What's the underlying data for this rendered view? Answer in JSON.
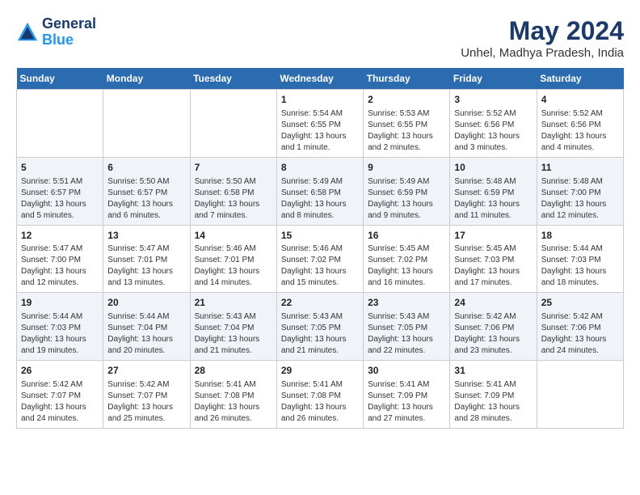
{
  "logo": {
    "line1": "General",
    "line2": "Blue"
  },
  "title": "May 2024",
  "subtitle": "Unhel, Madhya Pradesh, India",
  "headers": [
    "Sunday",
    "Monday",
    "Tuesday",
    "Wednesday",
    "Thursday",
    "Friday",
    "Saturday"
  ],
  "weeks": [
    [
      {
        "day": "",
        "content": ""
      },
      {
        "day": "",
        "content": ""
      },
      {
        "day": "",
        "content": ""
      },
      {
        "day": "1",
        "content": "Sunrise: 5:54 AM\nSunset: 6:55 PM\nDaylight: 13 hours\nand 1 minute."
      },
      {
        "day": "2",
        "content": "Sunrise: 5:53 AM\nSunset: 6:55 PM\nDaylight: 13 hours\nand 2 minutes."
      },
      {
        "day": "3",
        "content": "Sunrise: 5:52 AM\nSunset: 6:56 PM\nDaylight: 13 hours\nand 3 minutes."
      },
      {
        "day": "4",
        "content": "Sunrise: 5:52 AM\nSunset: 6:56 PM\nDaylight: 13 hours\nand 4 minutes."
      }
    ],
    [
      {
        "day": "5",
        "content": "Sunrise: 5:51 AM\nSunset: 6:57 PM\nDaylight: 13 hours\nand 5 minutes."
      },
      {
        "day": "6",
        "content": "Sunrise: 5:50 AM\nSunset: 6:57 PM\nDaylight: 13 hours\nand 6 minutes."
      },
      {
        "day": "7",
        "content": "Sunrise: 5:50 AM\nSunset: 6:58 PM\nDaylight: 13 hours\nand 7 minutes."
      },
      {
        "day": "8",
        "content": "Sunrise: 5:49 AM\nSunset: 6:58 PM\nDaylight: 13 hours\nand 8 minutes."
      },
      {
        "day": "9",
        "content": "Sunrise: 5:49 AM\nSunset: 6:59 PM\nDaylight: 13 hours\nand 9 minutes."
      },
      {
        "day": "10",
        "content": "Sunrise: 5:48 AM\nSunset: 6:59 PM\nDaylight: 13 hours\nand 11 minutes."
      },
      {
        "day": "11",
        "content": "Sunrise: 5:48 AM\nSunset: 7:00 PM\nDaylight: 13 hours\nand 12 minutes."
      }
    ],
    [
      {
        "day": "12",
        "content": "Sunrise: 5:47 AM\nSunset: 7:00 PM\nDaylight: 13 hours\nand 12 minutes."
      },
      {
        "day": "13",
        "content": "Sunrise: 5:47 AM\nSunset: 7:01 PM\nDaylight: 13 hours\nand 13 minutes."
      },
      {
        "day": "14",
        "content": "Sunrise: 5:46 AM\nSunset: 7:01 PM\nDaylight: 13 hours\nand 14 minutes."
      },
      {
        "day": "15",
        "content": "Sunrise: 5:46 AM\nSunset: 7:02 PM\nDaylight: 13 hours\nand 15 minutes."
      },
      {
        "day": "16",
        "content": "Sunrise: 5:45 AM\nSunset: 7:02 PM\nDaylight: 13 hours\nand 16 minutes."
      },
      {
        "day": "17",
        "content": "Sunrise: 5:45 AM\nSunset: 7:03 PM\nDaylight: 13 hours\nand 17 minutes."
      },
      {
        "day": "18",
        "content": "Sunrise: 5:44 AM\nSunset: 7:03 PM\nDaylight: 13 hours\nand 18 minutes."
      }
    ],
    [
      {
        "day": "19",
        "content": "Sunrise: 5:44 AM\nSunset: 7:03 PM\nDaylight: 13 hours\nand 19 minutes."
      },
      {
        "day": "20",
        "content": "Sunrise: 5:44 AM\nSunset: 7:04 PM\nDaylight: 13 hours\nand 20 minutes."
      },
      {
        "day": "21",
        "content": "Sunrise: 5:43 AM\nSunset: 7:04 PM\nDaylight: 13 hours\nand 21 minutes."
      },
      {
        "day": "22",
        "content": "Sunrise: 5:43 AM\nSunset: 7:05 PM\nDaylight: 13 hours\nand 21 minutes."
      },
      {
        "day": "23",
        "content": "Sunrise: 5:43 AM\nSunset: 7:05 PM\nDaylight: 13 hours\nand 22 minutes."
      },
      {
        "day": "24",
        "content": "Sunrise: 5:42 AM\nSunset: 7:06 PM\nDaylight: 13 hours\nand 23 minutes."
      },
      {
        "day": "25",
        "content": "Sunrise: 5:42 AM\nSunset: 7:06 PM\nDaylight: 13 hours\nand 24 minutes."
      }
    ],
    [
      {
        "day": "26",
        "content": "Sunrise: 5:42 AM\nSunset: 7:07 PM\nDaylight: 13 hours\nand 24 minutes."
      },
      {
        "day": "27",
        "content": "Sunrise: 5:42 AM\nSunset: 7:07 PM\nDaylight: 13 hours\nand 25 minutes."
      },
      {
        "day": "28",
        "content": "Sunrise: 5:41 AM\nSunset: 7:08 PM\nDaylight: 13 hours\nand 26 minutes."
      },
      {
        "day": "29",
        "content": "Sunrise: 5:41 AM\nSunset: 7:08 PM\nDaylight: 13 hours\nand 26 minutes."
      },
      {
        "day": "30",
        "content": "Sunrise: 5:41 AM\nSunset: 7:09 PM\nDaylight: 13 hours\nand 27 minutes."
      },
      {
        "day": "31",
        "content": "Sunrise: 5:41 AM\nSunset: 7:09 PM\nDaylight: 13 hours\nand 28 minutes."
      },
      {
        "day": "",
        "content": ""
      }
    ]
  ]
}
